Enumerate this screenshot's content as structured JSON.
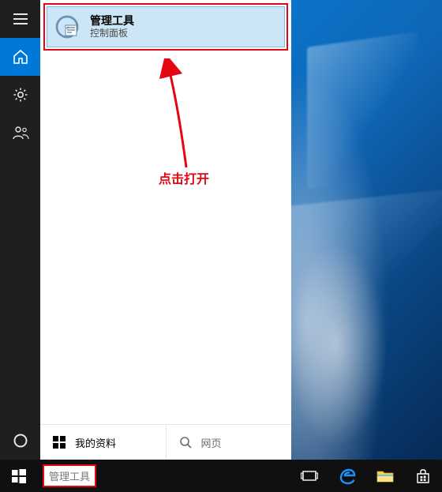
{
  "colors": {
    "accent": "#0078d7",
    "annotation": "#e30613"
  },
  "rail": {
    "items": [
      {
        "name": "hamburger-icon"
      },
      {
        "name": "home-icon",
        "active": true
      },
      {
        "name": "gear-icon"
      },
      {
        "name": "people-icon"
      },
      {
        "name": "cortana-icon"
      }
    ]
  },
  "best_match": {
    "title": "管理工具",
    "subtitle": "控制面板",
    "icon_name": "admin-tools-icon"
  },
  "annotation": {
    "label": "点击打开"
  },
  "tabs": {
    "mine": {
      "label": "我的资料",
      "active": true
    },
    "web": {
      "label": "网页",
      "active": false
    }
  },
  "search": {
    "value": "管理工具"
  },
  "taskbar_icons": [
    {
      "name": "task-view-icon"
    },
    {
      "name": "edge-icon"
    },
    {
      "name": "file-explorer-icon"
    },
    {
      "name": "store-icon"
    }
  ]
}
